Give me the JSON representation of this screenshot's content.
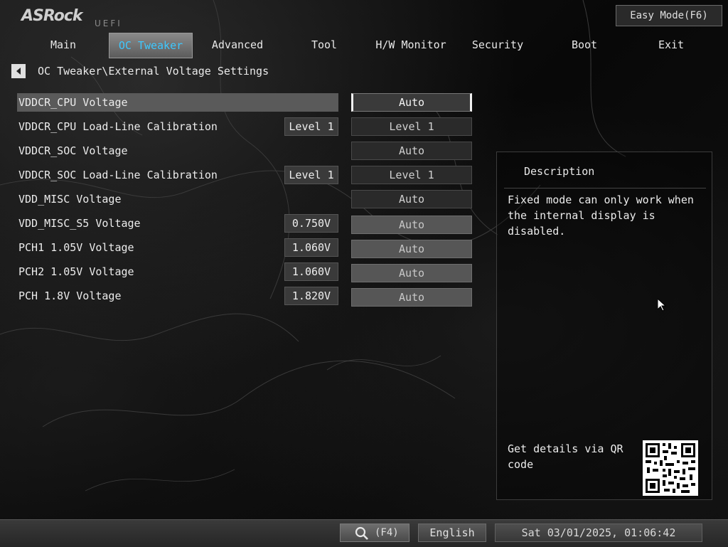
{
  "brand": {
    "logo": "ASRock",
    "sub": "UEFI"
  },
  "easy_mode_label": "Easy Mode(F6)",
  "tabs": [
    {
      "label": "Main"
    },
    {
      "label": "OC Tweaker",
      "active": true
    },
    {
      "label": "Advanced"
    },
    {
      "label": "Tool"
    },
    {
      "label": "H/W Monitor"
    },
    {
      "label": "Security"
    },
    {
      "label": "Boot"
    },
    {
      "label": "Exit"
    }
  ],
  "breadcrumb": "OC Tweaker\\External Voltage Settings",
  "settings": [
    {
      "label": "VDDCR_CPU Voltage",
      "current": "",
      "option": "Auto",
      "selected": true
    },
    {
      "label": "VDDCR_CPU Load-Line Calibration",
      "current": "Level 1",
      "option": "Level 1"
    },
    {
      "label": "VDDCR_SOC Voltage",
      "current": "",
      "option": "Auto"
    },
    {
      "label": "VDDCR_SOC Load-Line Calibration",
      "current": "Level 1",
      "option": "Level 1"
    },
    {
      "label": "VDD_MISC Voltage",
      "current": "",
      "option": "Auto"
    },
    {
      "label": "VDD_MISC_S5 Voltage",
      "current": "0.750V",
      "option": "Auto"
    },
    {
      "label": "PCH1 1.05V Voltage",
      "current": "1.060V",
      "option": "Auto"
    },
    {
      "label": "PCH2 1.05V Voltage",
      "current": "1.060V",
      "option": "Auto"
    },
    {
      "label": "PCH 1.8V Voltage",
      "current": "1.820V",
      "option": "Auto"
    }
  ],
  "description": {
    "title": "Description",
    "text": "Fixed mode can only work when the internal display is disabled.",
    "qr_text": "Get details via QR code"
  },
  "bottom": {
    "search_label": "(F4)",
    "language": "English",
    "datetime": "Sat 03/01/2025, 01:06:42"
  },
  "icons": {
    "back": "back-arrow-icon",
    "search": "magnifier-icon",
    "cursor": "mouse-pointer-icon",
    "qr": "qr-code-icon"
  }
}
